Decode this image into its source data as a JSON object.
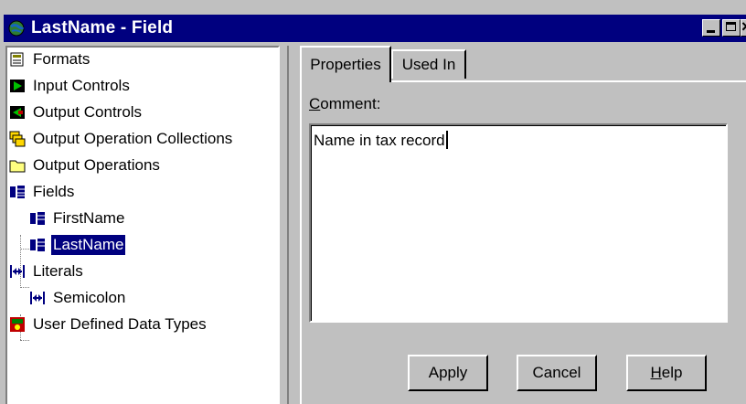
{
  "window": {
    "title": "LastName - Field"
  },
  "tree": {
    "items": [
      {
        "label": "Formats",
        "icon": "formats-icon"
      },
      {
        "label": "Input Controls",
        "icon": "input-controls-icon"
      },
      {
        "label": "Output Controls",
        "icon": "output-controls-icon"
      },
      {
        "label": "Output Operation Collections",
        "icon": "output-operation-collections-icon"
      },
      {
        "label": "Output Operations",
        "icon": "folder-icon"
      },
      {
        "label": "Fields",
        "icon": "fields-icon"
      },
      {
        "label": "FirstName",
        "icon": "field-icon"
      },
      {
        "label": "LastName",
        "icon": "field-icon",
        "selected": true
      },
      {
        "label": "Literals",
        "icon": "literals-icon"
      },
      {
        "label": "Semicolon",
        "icon": "literal-icon"
      },
      {
        "label": "User Defined Data Types",
        "icon": "user-defined-data-types-icon"
      }
    ]
  },
  "tabs": [
    {
      "label": "Properties",
      "active": true
    },
    {
      "label": "Used In",
      "active": false
    }
  ],
  "comment": {
    "label_mnemonic": "C",
    "label_rest": "omment:",
    "value": "Name in tax record"
  },
  "buttons": {
    "apply": "Apply",
    "cancel": "Cancel",
    "help_mnemonic": "H",
    "help_rest": "elp"
  },
  "colors": {
    "titlebar": "#00007f",
    "face": "#c0c0c0",
    "selection": "#00007f"
  }
}
